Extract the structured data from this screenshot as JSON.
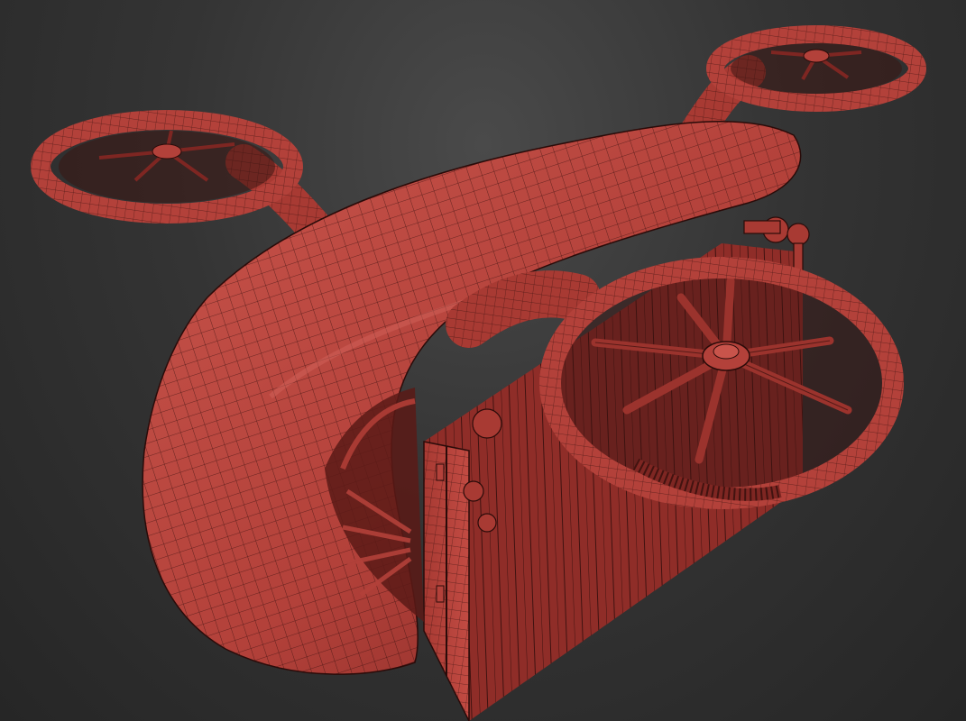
{
  "viewport": {
    "background": "#2e2e2e",
    "render_mode": "wireframe-on-shaded"
  },
  "model": {
    "subject": "cargo-drone-with-container",
    "base_color": "#b3413a",
    "shade_color": "#7e2622",
    "highlight_color": "#d2625a",
    "wire_color": "#2a0b09",
    "parts": [
      "curved-canopy",
      "front-left-rotor",
      "front-right-rotor",
      "rear-right-rotor",
      "rear-left-rotor",
      "shipping-container",
      "rotor-arms"
    ]
  }
}
